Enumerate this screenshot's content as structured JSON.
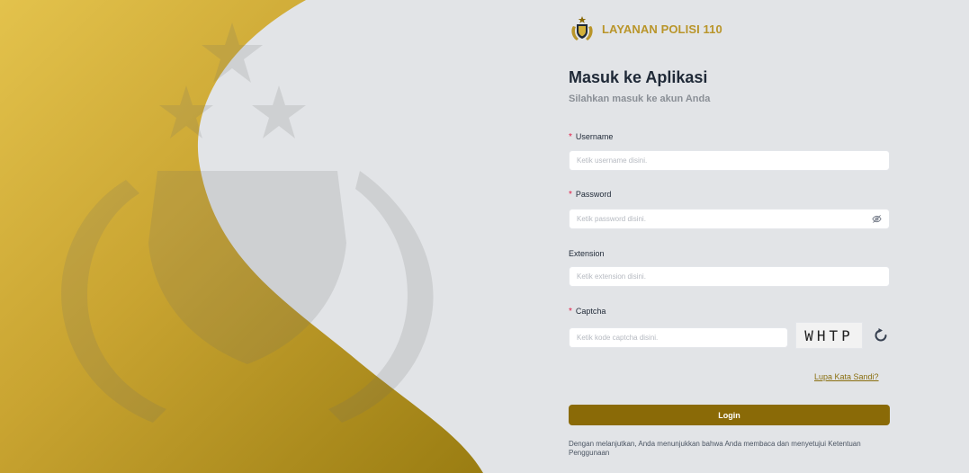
{
  "brand": {
    "name": "LAYANAN POLISI 110",
    "logo_icon": "police-emblem-icon"
  },
  "form": {
    "title": "Masuk ke Aplikasi",
    "subtitle": "Silahkan masuk ke akun Anda",
    "username": {
      "label": "Username",
      "required_mark": "*",
      "placeholder": "Ketik username disini.",
      "value": ""
    },
    "password": {
      "label": "Password",
      "required_mark": "*",
      "placeholder": "Ketik password disini.",
      "value": "",
      "toggle_icon": "eye-off-icon"
    },
    "extension": {
      "label": "Extension",
      "placeholder": "Ketik extension disini.",
      "value": ""
    },
    "captcha": {
      "label": "Captcha",
      "required_mark": "*",
      "placeholder": "Ketik kode captcha disini.",
      "value": "",
      "code": "WHTP",
      "refresh_icon": "refresh-icon"
    },
    "forgot_label": "Lupa Kata Sandi?",
    "login_label": "Login",
    "terms_text": "Dengan melanjutkan, Anda menunjukkan bahwa Anda membaca dan menyetujui Ketentuan Penggunaan"
  },
  "colors": {
    "gold": "#b9952a",
    "gold_dark": "#8a6a07",
    "background": "#e2e4e7",
    "required": "#e11d48"
  }
}
